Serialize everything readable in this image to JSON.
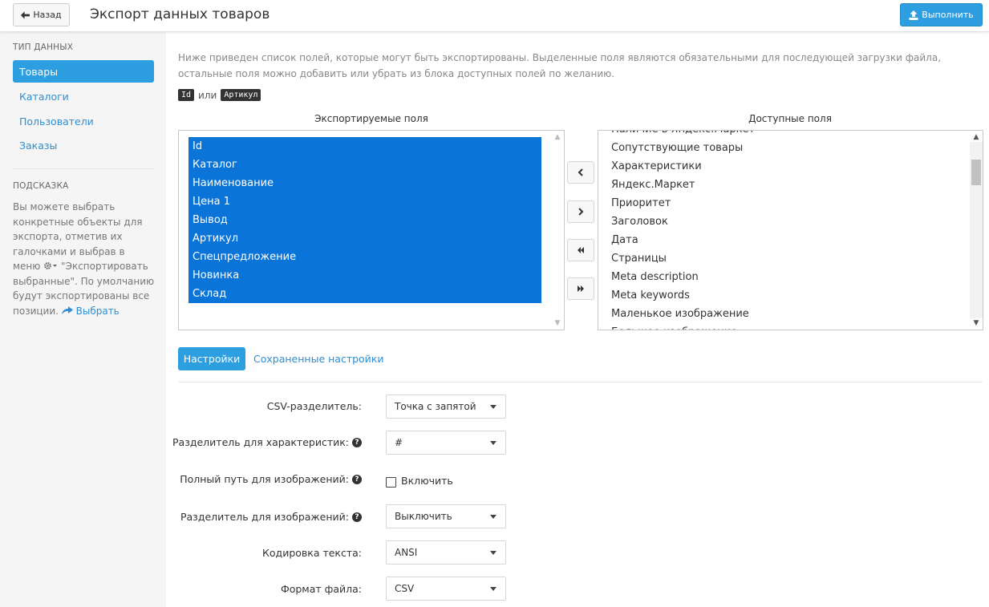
{
  "header": {
    "back_label": "Назад",
    "title": "Экспорт данных товаров",
    "run_label": "Выполнить"
  },
  "sidebar": {
    "data_type_heading": "ТИП ДАННЫХ",
    "items": [
      {
        "label": "Товары",
        "active": true
      },
      {
        "label": "Каталоги",
        "active": false
      },
      {
        "label": "Пользователи",
        "active": false
      },
      {
        "label": "Заказы",
        "active": false
      }
    ],
    "hint_heading": "ПОДСКАЗКА",
    "hint_text_1": "Вы можете выбрать конкретные объекты для экспорта, отметив их галочками и выбрав в меню",
    "hint_text_2": "\"Экспортировать выбранные\". По умолчанию будут экспортированы все позиции.",
    "hint_link": "Выбрать"
  },
  "intro": {
    "text": "Ниже приведен список полей, которые могут быть экспортированы. Выделенные поля являются обязательными для последующей загрузки файла, остальные поля можно добавить или убрать из блока доступных полей по желанию.",
    "key_1": "Id",
    "or": "или",
    "key_2": "Артикул"
  },
  "exported": {
    "title": "Экспортируемые поля",
    "items": [
      "Id",
      "Каталог",
      "Наименование",
      "Цена 1",
      "Вывод",
      "Артикул",
      "Спецпредложение",
      "Новинка",
      "Склад"
    ]
  },
  "available": {
    "title": "Доступные поля",
    "items": [
      "Наличие в Яндекс.Маркет",
      "Сопутствующие товары",
      "Характеристики",
      "Яндекс.Маркет",
      "Приоритет",
      "Заголовок",
      "Дата",
      "Страницы",
      "Meta description",
      "Meta keywords",
      "Маленькое изображение",
      "Большое изображение"
    ]
  },
  "tabs": {
    "settings": "Настройки",
    "saved": "Сохраненные настройки"
  },
  "form": {
    "csv_separator": {
      "label": "CSV-разделитель:",
      "value": "Точка с запятой"
    },
    "char_separator": {
      "label": "Разделитель для характеристик:",
      "value": "#"
    },
    "full_path": {
      "label": "Полный путь для изображений:",
      "checkbox_label": "Включить",
      "checked": false
    },
    "img_separator": {
      "label": "Разделитель для изображений:",
      "value": "Выключить"
    },
    "encoding": {
      "label": "Кодировка текста:",
      "value": "ANSI"
    },
    "format": {
      "label": "Формат файла:",
      "value": "CSV"
    }
  },
  "colors": {
    "accent": "#2d9ee0",
    "selection": "#0b74d8",
    "link": "#2d8fd5"
  },
  "icons": {
    "back": "arrow-left-icon",
    "run": "upload-icon",
    "help": "question-circle-icon",
    "gear": "gear-icon",
    "share": "share-arrow-icon"
  }
}
